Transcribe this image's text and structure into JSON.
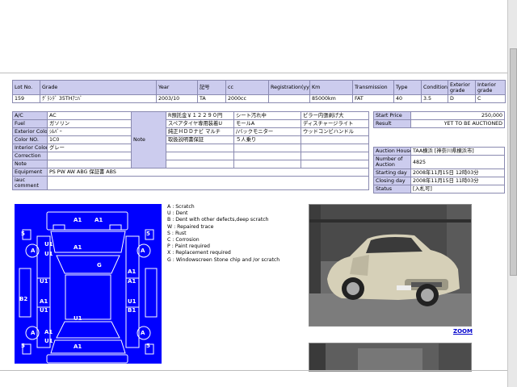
{
  "header_table": {
    "labels": [
      "Lot No.",
      "Grade",
      "Year",
      "記号",
      "cc",
      "Registration(yy/mm)",
      "Km",
      "Transmission",
      "Type",
      "Condition",
      "Exterior grade",
      "Interior grade"
    ],
    "values": [
      "159",
      "ｸﾞﾗﾝﾃﾞ 35THｱﾆﾊﾞ",
      "2003/10",
      "TA",
      "2000cc",
      "",
      "85000km",
      "FAT",
      "40",
      "3.5",
      "D",
      "C"
    ]
  },
  "spec_table": {
    "ac_label": "A/C",
    "ac_value": "AC",
    "fuel_label": "Fuel",
    "fuel_value": "ガソリン",
    "ext_color_label": "Exterior Color",
    "ext_color_value": "ｼﾙﾊﾞｰ",
    "color_no_label": "Color NO.",
    "color_no_value": "1C0",
    "int_color_label": "Interior Color",
    "int_color_value": "グレー",
    "correction_label": "Correction",
    "note_small_label": "Note",
    "equipment_label": "Equipment",
    "equipment_value": "PS PW AW ABG 保証書 ABS",
    "iauc_label": "iauc comment",
    "note_label": "Note",
    "notes": [
      [
        "R預託金￥１２２９０円",
        "シート汚れ中",
        "ピラー内張剥げ大"
      ],
      [
        "スペアタイヤ専用装着U",
        "モールA",
        "ディスチャージライト"
      ],
      [
        "純正ＨＤＤナビ マルチ",
        "/バックモニター",
        "ウッドコンビハンドル"
      ],
      [
        "取扱説明書保証",
        "５人乗り",
        ""
      ]
    ]
  },
  "price_table": {
    "start_label": "Start Price",
    "start_value": "250,000",
    "result_label": "Result",
    "result_value": "YET TO BE AUCTIONED"
  },
  "auction_table": {
    "house_label": "Auction House",
    "house_value": "TAA横浜 [神奈川県横浜市]",
    "number_label": "Number of Auction",
    "number_value": "4825",
    "start_day_label": "Starting day",
    "start_day_value": "2008年11月15日 12時03分",
    "close_day_label": "Closing day",
    "close_day_value": "2008年11月15日 11時03分",
    "status_label": "Status",
    "status_value": "[入札可]"
  },
  "legend": [
    "A : Scratch",
    "U : Dent",
    "B : Dent with other defects,deep scratch",
    "W : Repaired trace",
    "S : Rust",
    "C : Corrosion",
    "P : Paint required",
    "X : Replacement required",
    "G : Windowscreen Stone chip and /or scratch"
  ],
  "sheet_marks": [
    {
      "t": "A1"
    },
    {
      "t": "A1"
    },
    {
      "t": "5"
    },
    {
      "t": "5"
    },
    {
      "t": "A"
    },
    {
      "t": "U1"
    },
    {
      "t": "U1"
    },
    {
      "t": "A1"
    },
    {
      "t": "A"
    },
    {
      "t": "G"
    },
    {
      "t": "U1"
    },
    {
      "t": "A1"
    },
    {
      "t": "A1"
    },
    {
      "t": "B2"
    },
    {
      "t": "A1"
    },
    {
      "t": "U1"
    },
    {
      "t": "U1"
    },
    {
      "t": "U1"
    },
    {
      "t": "B1"
    },
    {
      "t": "A1"
    },
    {
      "t": "U1"
    },
    {
      "t": "A"
    },
    {
      "t": "A"
    },
    {
      "t": "5"
    },
    {
      "t": "5"
    },
    {
      "t": "A1"
    }
  ],
  "zoom_label": "ZOOM",
  "colors": {
    "header_bg": "#ccccee",
    "sheet_blue": "#0000ff",
    "link": "#0000cc"
  }
}
